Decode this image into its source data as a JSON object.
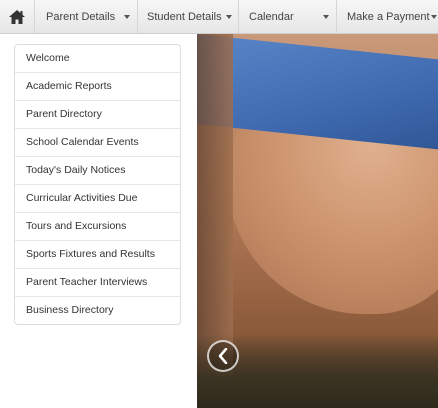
{
  "navbar": {
    "items": [
      {
        "label": "Parent Details"
      },
      {
        "label": "Student Details"
      },
      {
        "label": "Calendar"
      },
      {
        "label": "Make a Payment"
      }
    ]
  },
  "sidebar": {
    "items": [
      {
        "label": "Welcome"
      },
      {
        "label": "Academic Reports"
      },
      {
        "label": "Parent Directory"
      },
      {
        "label": "School Calendar Events"
      },
      {
        "label": "Today's Daily Notices"
      },
      {
        "label": "Curricular Activities Due"
      },
      {
        "label": "Tours and Excursions"
      },
      {
        "label": "Sports Fixtures and Results"
      },
      {
        "label": "Parent Teacher Interviews"
      },
      {
        "label": "Business Directory"
      }
    ]
  },
  "carousel": {
    "prev_icon": "chevron-left-icon"
  },
  "colors": {
    "navbar_bg": "#eeeeee",
    "sidebar_border": "#dddddd",
    "text": "#333333"
  }
}
